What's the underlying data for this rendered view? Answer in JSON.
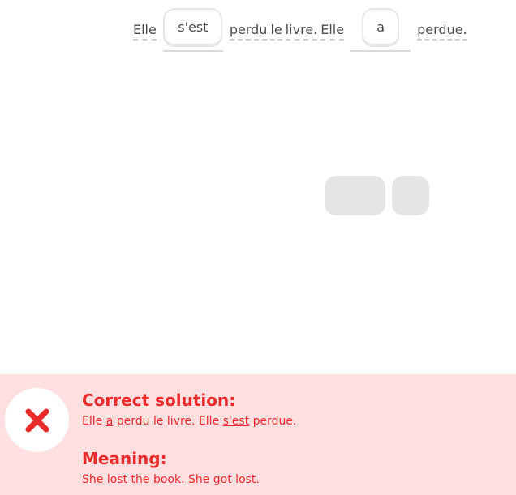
{
  "sentence": {
    "w1": "Elle",
    "slot1": "s'est",
    "w2": "perdu",
    "w3": "le",
    "w4": "livre.",
    "w5": "Elle",
    "slot2": "a",
    "w6": "perdue."
  },
  "feedback": {
    "status": "incorrect",
    "icon": "close-icon",
    "accent_color": "#ea2b2b",
    "background_color": "#ffdfe0",
    "correct_title": "Correct solution:",
    "solution": {
      "p1": "Elle ",
      "u1": "a",
      "p2": " perdu le livre. Elle ",
      "u2": "s'est",
      "p3": " perdue."
    },
    "meaning_title": "Meaning:",
    "meaning_text": "She lost the book. She got lost."
  }
}
